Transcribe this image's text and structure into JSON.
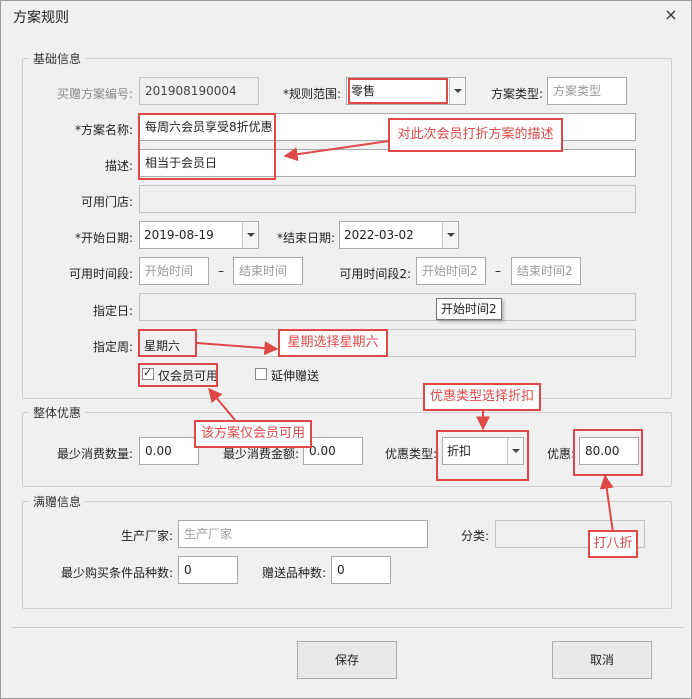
{
  "window": {
    "title": "方案规则",
    "close": "×"
  },
  "basic": {
    "legend": "基础信息",
    "plan_no_label": "买赠方案编号:",
    "plan_no_value": "201908190004",
    "scope_label": "*规则范围:",
    "scope_value": "零售",
    "type_label": "方案类型:",
    "type_placeholder": "方案类型",
    "name_label": "*方案名称:",
    "name_value": "每周六会员享受8折优惠",
    "desc_label": "描述:",
    "desc_value": "相当于会员日",
    "stores_label": "可用门店:",
    "start_label": "*开始日期:",
    "start_value": "2019-08-19",
    "end_label": "*结束日期:",
    "end_value": "2022-03-02",
    "period1_label": "可用时间段:",
    "period1_start_ph": "开始时间",
    "period1_end_ph": "结束时间",
    "period2_label": "可用时间段2:",
    "period2_start_ph": "开始时间2",
    "period2_end_ph": "结束时间2",
    "dash": "–",
    "day_label": "指定日:",
    "tooltip": "开始时间2",
    "week_label": "指定周:",
    "week_value": "星期六",
    "member_only_label": "仅会员可用",
    "extend_gift_label": "延伸赠送"
  },
  "discount": {
    "legend": "整体优惠",
    "min_qty_label": "最少消费数量:",
    "min_qty_value": "0.00",
    "min_amt_label": "最少消费金额:",
    "min_amt_value": "0.00",
    "type_label": "优惠类型:",
    "type_value": "折扣",
    "value_label": "优惠:",
    "value_value": "80.00"
  },
  "gift": {
    "legend": "满赠信息",
    "maker_label": "生产厂家:",
    "maker_placeholder": "生产厂家",
    "category_label": "分类:",
    "min_kinds_label": "最少购买条件品种数:",
    "min_kinds_value": "0",
    "gift_kinds_label": "赠送品种数:",
    "gift_kinds_value": "0"
  },
  "buttons": {
    "save": "保存",
    "cancel": "取消"
  },
  "annotations": {
    "desc_note": "对此次会员打折方案的描述",
    "week_note": "星期选择星期六",
    "member_note": "该方案仅会员可用",
    "type_note": "优惠类型选择折扣",
    "value_note": "打八折"
  },
  "colors": {
    "annotation": "#e04848",
    "background": "#f0f0f0"
  }
}
